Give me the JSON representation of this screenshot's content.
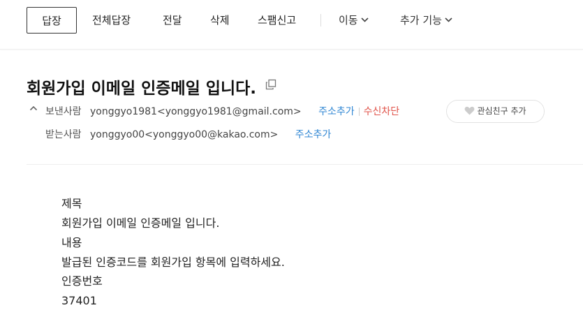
{
  "toolbar": {
    "reply": "답장",
    "reply_all": "전체답장",
    "forward": "전달",
    "delete": "삭제",
    "spam": "스팸신고",
    "move": "이동",
    "more": "추가 기능"
  },
  "mail": {
    "subject": "회원가입 이메일 인증메일 입니다.",
    "sender_label": "보낸사람",
    "sender": "yonggyo1981<yonggyo1981@gmail.com>",
    "add_address": "주소추가",
    "block": "수신차단",
    "vip_button": "관심친구 추가",
    "recipient_label": "받는사람",
    "recipient": "yonggyo00<yonggyo00@kakao.com>",
    "add_address_2": "주소추가"
  },
  "body": {
    "lines": [
      "제목",
      "회원가입 이메일 인증메일 입니다.",
      "내용",
      "발급된 인증코드를 회원가입 항목에 입력하세요.",
      "인증번호",
      "37401"
    ]
  },
  "colors": {
    "link": "#2f86d3",
    "block": "#e0534a",
    "divider": "#eeeeee"
  },
  "icons": {
    "copy": "copy-icon",
    "caret": "caret-up-icon",
    "chevron": "chevron-down-icon",
    "heart": "heart-icon"
  }
}
